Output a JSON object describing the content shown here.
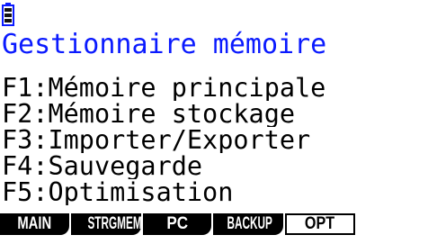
{
  "status_bar": {
    "battery_icon": "battery-icon",
    "battery_color": "#0a1aff"
  },
  "title": "Gestionnaire mémoire",
  "menu": {
    "items": [
      {
        "label": "F1:Mémoire principale"
      },
      {
        "label": "F2:Mémoire stockage"
      },
      {
        "label": "F3:Importer/Exporter"
      },
      {
        "label": "F4:Sauvegarde"
      },
      {
        "label": "F5:Optimisation"
      }
    ]
  },
  "function_keys": [
    {
      "label": "MAIN",
      "style": "filled"
    },
    {
      "label": "STRGMEM",
      "style": "filled"
    },
    {
      "label": "PC",
      "style": "filled"
    },
    {
      "label": "BACKUP",
      "style": "filled"
    },
    {
      "label": "OPT",
      "style": "outlined"
    }
  ],
  "colors": {
    "title": "#0a1aff",
    "text": "#000000",
    "background": "#ffffff"
  }
}
